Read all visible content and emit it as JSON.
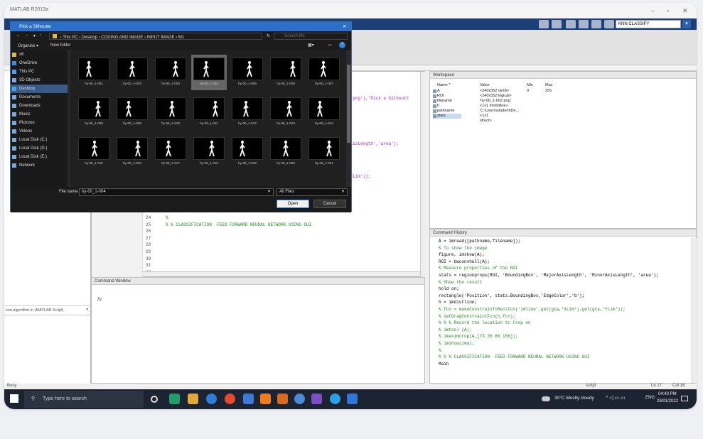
{
  "matlab": {
    "title": "MATLAB R2013a",
    "classify_field": "KNN CLASSIFY",
    "editor": {
      "lines": [
        {
          "no": "24",
          "code": "%"
        },
        {
          "no": "25",
          "code": "% % CLASSIFICATION  FEED FORWARD NEURAL NETWORK USING GUI"
        },
        {
          "no": "26",
          "code": ""
        },
        {
          "no": "27",
          "code": ""
        },
        {
          "no": "28",
          "code": ""
        },
        {
          "no": "29",
          "code": ""
        },
        {
          "no": "30",
          "code": ""
        },
        {
          "no": "31",
          "code": ""
        },
        {
          "no": "32",
          "code": ""
        }
      ],
      "partial1": "*.png'),'Pick a Silhoutt",
      "partial2": "axisLength','area');",
      "partial3": "'XLim'));"
    },
    "command_window": {
      "title": "Command Window",
      "prompt": "fx"
    },
    "current_folder_detail": "knn.algorithm.m  (MATLAB Script)",
    "workspace": {
      "title": "Workspace",
      "headers": [
        "Name ^",
        "Value",
        "Min",
        "Max"
      ],
      "rows": [
        {
          "name": "A",
          "value": "<240x352 uint8>",
          "min": "0",
          "max": "255"
        },
        {
          "name": "ROI",
          "value": "<240x352 logical>",
          "min": "",
          "max": ""
        },
        {
          "name": "filename",
          "value": "'hy-00_1-002.png'",
          "min": "",
          "max": ""
        },
        {
          "name": "h",
          "value": "<1x1 imdistline>",
          "min": "",
          "max": ""
        },
        {
          "name": "pathname",
          "value": "'C:\\Users\\student\\De...",
          "min": "",
          "max": ""
        },
        {
          "name": "stats",
          "value": "<1x1 struct>",
          "min": "",
          "max": ""
        }
      ]
    },
    "history": {
      "title": "Command History",
      "lines": [
        "A = imread([pathname,filename]);",
        "% To show the image",
        "figure, imshow(A);",
        "ROI = bwconvhull(A);",
        "% Measure properties of the ROI",
        "stats = regionprops(ROI, 'BoundingBox', 'MajorAxisLength', 'MinorAxisLength', 'area');",
        "% Show the result",
        "hold on;",
        "rectangle('Position', stats.BoundingBox,'EdgeColor','b');",
        "h = imdistline;",
        "% fcn = makeConstrainToRectFcn('imline',get(gca,'XLim'),get(gca,'YLim'));",
        "% setDragConstraintFcn(h,fcn);",
        "% % % Record the location to Crop on",
        "% imtool (A);",
        "% ima=imcrop(A,[73 35 66 156]);",
        "% imshow(ima);",
        "%",
        "% % % CLASSIFICATION  FEED FORWARD NEURAL NETWORK USING GUI",
        "Main"
      ]
    },
    "status": {
      "left": "Busy",
      "script": "script",
      "ln": "Ln  17",
      "col": "Col  16"
    }
  },
  "dialog": {
    "title": "Pick a Silhoutte",
    "breadcrumb": [
      "This PC",
      "Desktop",
      "CODING AND IMAGE",
      "INPUT IMAGE",
      "M1"
    ],
    "search_placeholder": "Search M1",
    "organise": "Organise ▾",
    "new_folder": "New folder",
    "nav": [
      {
        "label": "s6",
        "icon": "folder-icon"
      },
      {
        "label": "OneDrive",
        "icon": "cloud-icon"
      },
      {
        "label": "This PC",
        "icon": "computer-icon"
      },
      {
        "label": "3D Objects",
        "icon": "cube-icon"
      },
      {
        "label": "Desktop",
        "icon": "desktop-icon",
        "selected": true
      },
      {
        "label": "Documents",
        "icon": "documents-icon"
      },
      {
        "label": "Downloads",
        "icon": "downloads-icon"
      },
      {
        "label": "Music",
        "icon": "music-icon"
      },
      {
        "label": "Pictures",
        "icon": "pictures-icon"
      },
      {
        "label": "Videos",
        "icon": "videos-icon"
      },
      {
        "label": "Local Disk (C:)",
        "icon": "drive-icon"
      },
      {
        "label": "Local Disk (D:)",
        "icon": "drive-icon"
      },
      {
        "label": "Local Disk (E:)",
        "icon": "drive-icon"
      },
      {
        "label": "Network",
        "icon": "network-icon"
      }
    ],
    "files": [
      "hy-00_1-001",
      "hy-00_1-002",
      "hy-00_1-003",
      "hy-00_1-004",
      "hy-00_1-005",
      "hy-00_1-006",
      "hy-00_1-007",
      "hy-00_1-008",
      "hy-00_1-009",
      "hy-00_1-010",
      "hy-00_1-011",
      "hy-00_1-012",
      "hy-00_1-013",
      "hy-00_1-014",
      "hy-00_1-015",
      "hy-00_1-016",
      "hy-00_1-017",
      "hy-00_1-018",
      "hy-00_1-019",
      "hy-00_1-020",
      "hy-00_1-021"
    ],
    "selected_file": "hy-00_1-004",
    "filename_label": "File name:",
    "filename_value": "hy-00_1-004",
    "filetype": "All Files",
    "open": "Open",
    "cancel": "Cancel"
  },
  "taskbar": {
    "search": "Type here to search",
    "weather": "30°C  Mostly cloudy",
    "lang": "ENG",
    "time": "04:43 PM",
    "date": "29/01/2022"
  }
}
